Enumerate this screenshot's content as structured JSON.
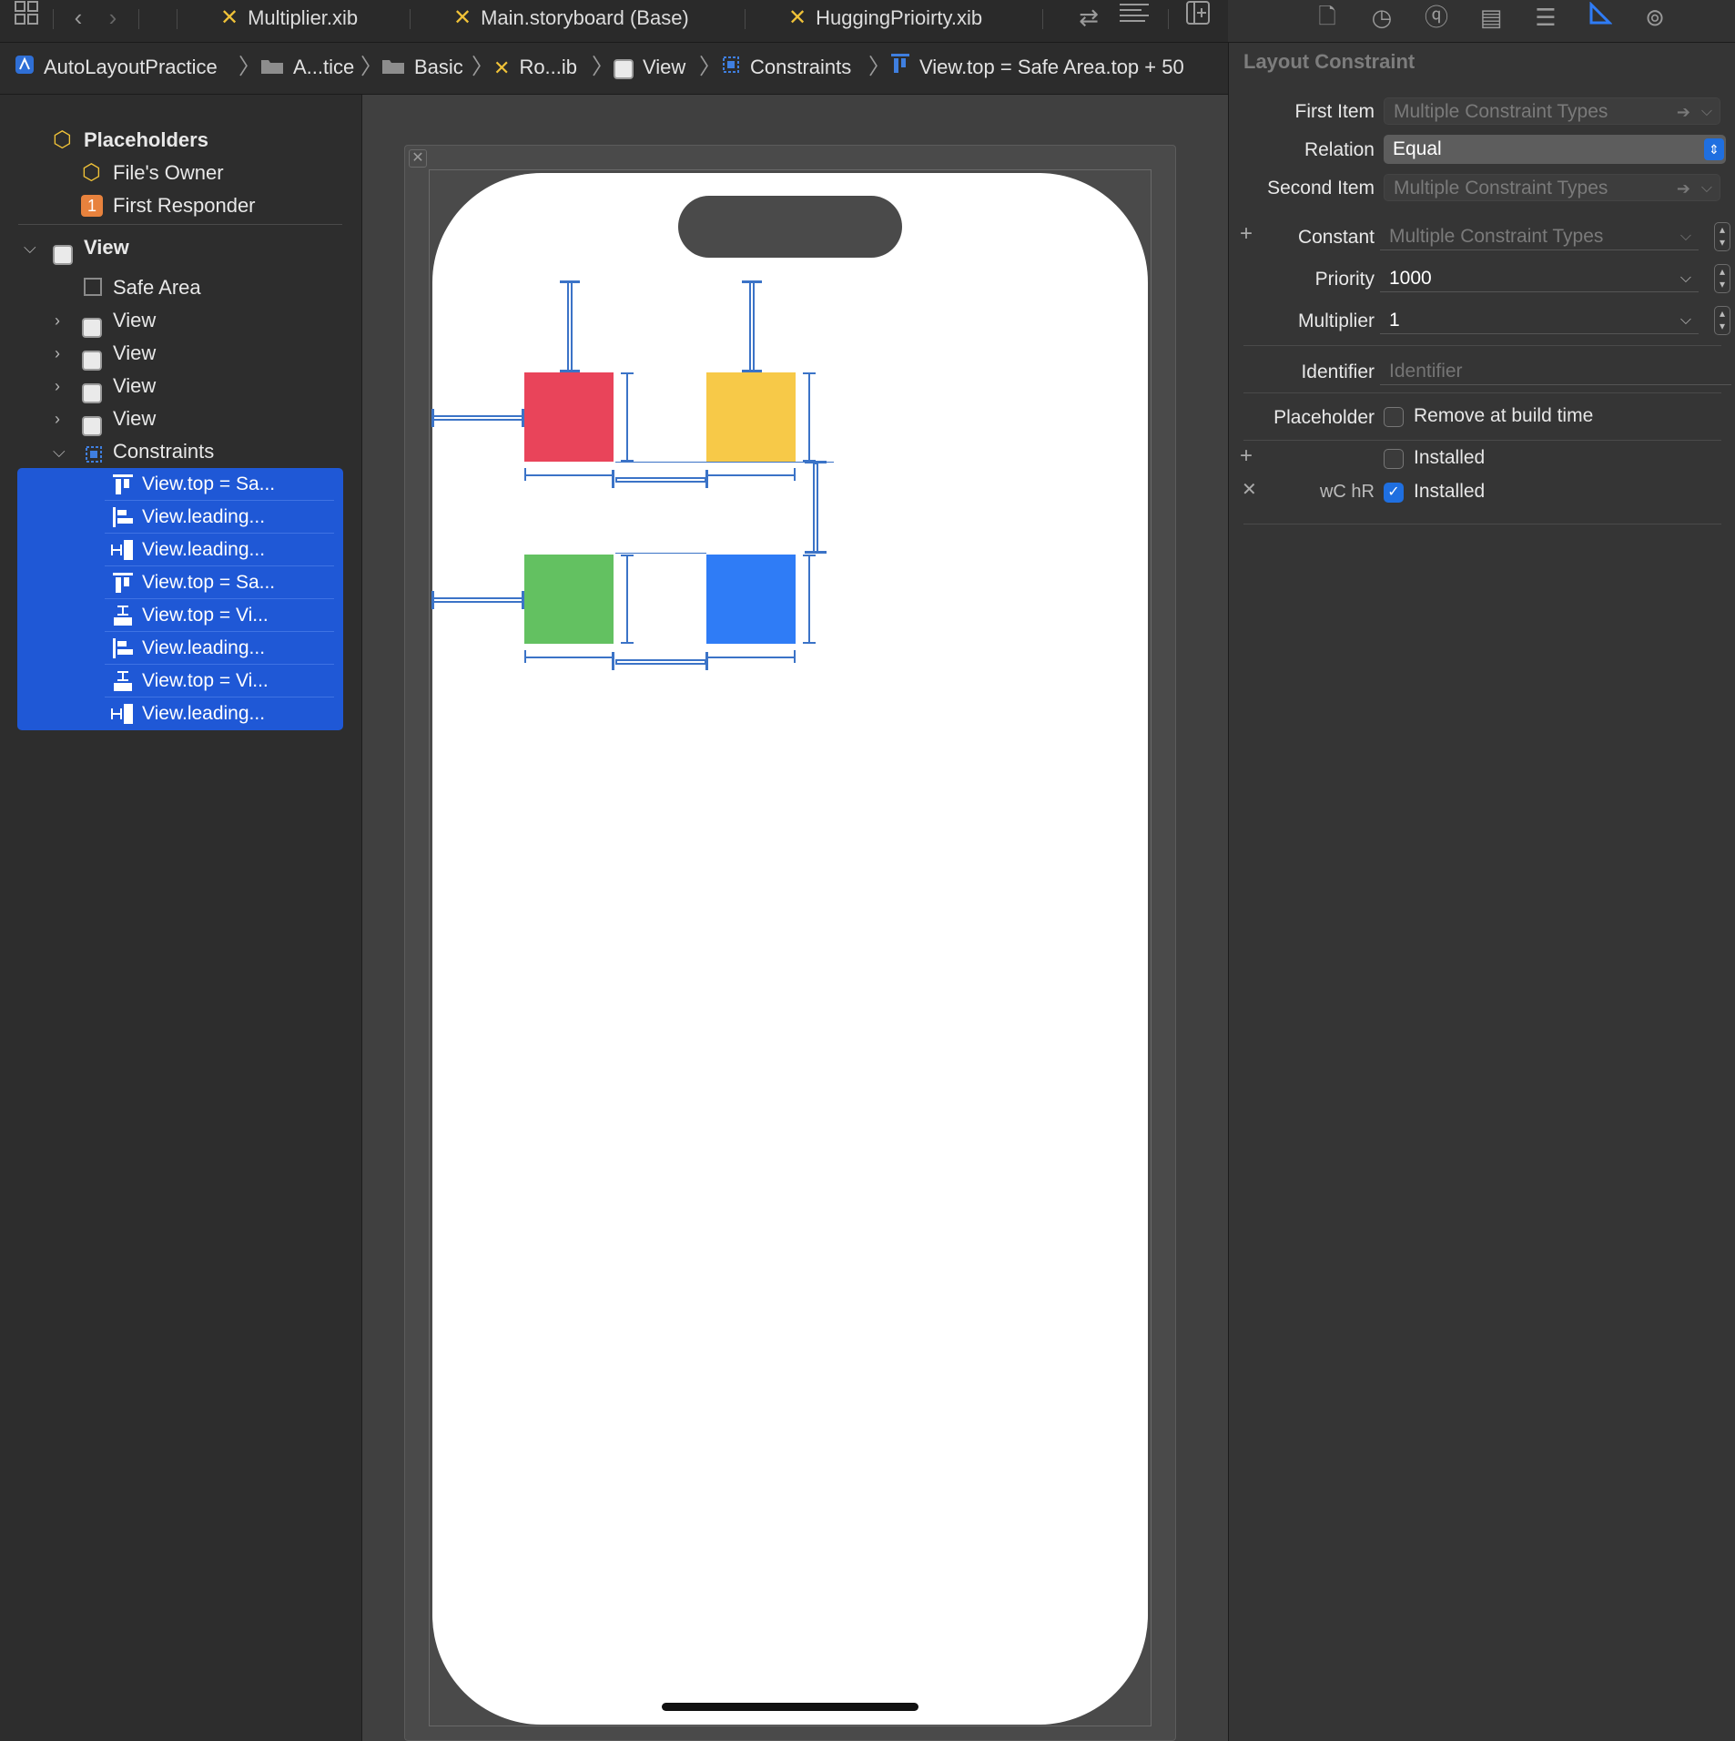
{
  "tabs": [
    {
      "label": "Multiplier.xib"
    },
    {
      "label": "Main.storyboard (Base)"
    },
    {
      "label": "HuggingPrioirty.xib"
    }
  ],
  "breadcrumb": [
    {
      "label": "AutoLayoutPractice",
      "icon": "app-icon"
    },
    {
      "label": "A...tice",
      "icon": "folder-icon"
    },
    {
      "label": "Basic",
      "icon": "folder-icon"
    },
    {
      "label": "Ro...ib",
      "icon": "xib-icon"
    },
    {
      "label": "View",
      "icon": "view-icon"
    },
    {
      "label": "Constraints",
      "icon": "constraints-icon"
    },
    {
      "label": "View.top = Safe Area.top + 50",
      "icon": "top-constraint-icon"
    }
  ],
  "outline": {
    "placeholders": "Placeholders",
    "files_owner": "File's Owner",
    "first_responder_badge": "1",
    "first_responder": "First Responder",
    "view": "View",
    "safe_area": "Safe Area",
    "subviews": [
      "View",
      "View",
      "View",
      "View"
    ],
    "constraints": "Constraints",
    "constraint_items": [
      "View.top = Sa...",
      "View.leading...",
      "View.leading...",
      "View.top = Sa...",
      "View.top = Vi...",
      "View.leading...",
      "View.top = Vi...",
      "View.leading..."
    ]
  },
  "canvas": {
    "box_colors": {
      "red": "#e9445a",
      "yellow": "#f7c948",
      "green": "#63c161",
      "blue": "#2f7cf6"
    },
    "constraint_color": "#3b73c7"
  },
  "inspector": {
    "title": "Layout Constraint",
    "first_item_label": "First Item",
    "first_item_value": "Multiple Constraint Types",
    "relation_label": "Relation",
    "relation_value": "Equal",
    "second_item_label": "Second Item",
    "second_item_value": "Multiple Constraint Types",
    "constant_label": "Constant",
    "constant_value": "Multiple Constraint Types",
    "priority_label": "Priority",
    "priority_value": "1000",
    "multiplier_label": "Multiplier",
    "multiplier_value": "1",
    "identifier_label": "Identifier",
    "identifier_placeholder": "Identifier",
    "placeholder_label": "Placeholder",
    "remove_at_build_time": "Remove at build time",
    "installed_label": "Installed",
    "variation": "wC hR",
    "variation_installed_label": "Installed",
    "accent": "#1f6fe0"
  }
}
